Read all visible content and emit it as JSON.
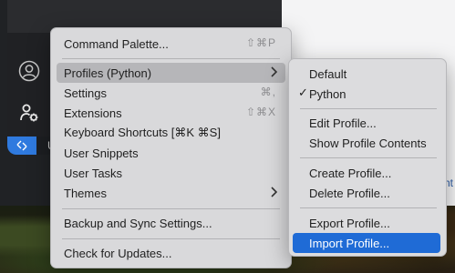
{
  "background": {
    "right_window_fragment": "ht"
  },
  "status_bar": {
    "text": "U"
  },
  "main_menu": {
    "items": [
      {
        "label": "Command Palette...",
        "shortcut": "⇧⌘P"
      },
      {
        "label": "Profiles (Python)"
      },
      {
        "label": "Settings",
        "shortcut": "⌘,"
      },
      {
        "label": "Extensions",
        "shortcut": "⇧⌘X"
      },
      {
        "label": "Keyboard Shortcuts [⌘K ⌘S]"
      },
      {
        "label": "User Snippets"
      },
      {
        "label": "User Tasks"
      },
      {
        "label": "Themes"
      },
      {
        "label": "Backup and Sync Settings..."
      },
      {
        "label": "Check for Updates..."
      }
    ]
  },
  "profiles_submenu": {
    "items": [
      {
        "label": "Default"
      },
      {
        "label": "Python",
        "checked": true,
        "check_mark": "✓"
      },
      {
        "label": "Edit Profile..."
      },
      {
        "label": "Show Profile Contents"
      },
      {
        "label": "Create Profile..."
      },
      {
        "label": "Delete Profile..."
      },
      {
        "label": "Export Profile..."
      },
      {
        "label": "Import Profile..."
      }
    ]
  },
  "colors": {
    "accent_blue": "#1f6bd6",
    "remote_blue": "#2f7adf",
    "menu_bg": "#d9d9db"
  },
  "icons": {
    "account": "account-icon",
    "manage": "gear-person-icon",
    "remote": "remote-icon",
    "chevron": "chevron-right-icon"
  }
}
